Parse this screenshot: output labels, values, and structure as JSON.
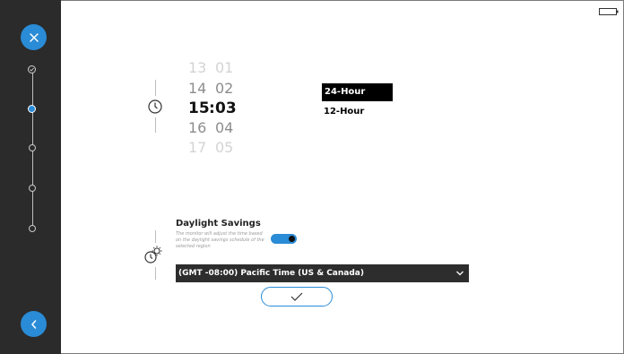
{
  "time": {
    "hours": [
      "13",
      "14",
      "15",
      "16",
      "17"
    ],
    "minutes": [
      "01",
      "02",
      "03",
      "04",
      "05"
    ],
    "separator": ":",
    "format_options": [
      "24-Hour",
      "12-Hour"
    ],
    "selected_format": "24-Hour"
  },
  "daylight": {
    "title": "Daylight Savings",
    "description_line1": "The monitor will adjust the time based",
    "description_line2": "on the daylight savings schedule of the selected region",
    "enabled": true
  },
  "timezone": {
    "selected": "(GMT -08:00) Pacific Time (US & Canada)"
  },
  "stepper": {
    "total_steps": 5,
    "current_step": 2
  },
  "colors": {
    "accent": "#2a8bd6",
    "sidebar": "#2b2b2b",
    "select_bg": "#2d2d2d"
  },
  "icons": {
    "close": "close-icon",
    "back": "chevron-left-icon",
    "clock": "clock-icon",
    "daylight": "sun-clock-icon",
    "confirm": "checkmark-icon",
    "dropdown": "chevron-down-icon",
    "battery": "battery-icon"
  }
}
